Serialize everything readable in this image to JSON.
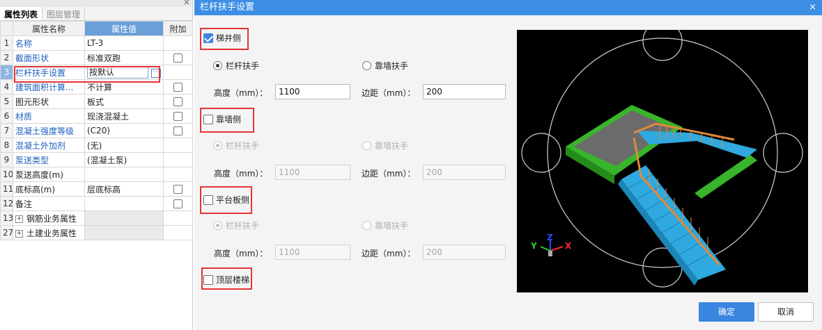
{
  "left_panel": {
    "tabs": [
      "属性列表",
      "图层管理"
    ],
    "columns": [
      "属性名称",
      "属性值",
      "附加"
    ],
    "rows": [
      {
        "num": "1",
        "name": "名称",
        "value": "LT-3"
      },
      {
        "num": "2",
        "name": "截面形状",
        "value": "标准双跑"
      },
      {
        "num": "3",
        "name": "栏杆扶手设置",
        "value": "按默认"
      },
      {
        "num": "4",
        "name": "建筑面积计算...",
        "value": "不计算"
      },
      {
        "num": "5",
        "name": "图元形状",
        "value": "板式"
      },
      {
        "num": "6",
        "name": "材质",
        "value": "现浇混凝土"
      },
      {
        "num": "7",
        "name": "混凝土强度等级",
        "value": "(C20)"
      },
      {
        "num": "8",
        "name": "混凝土外加剂",
        "value": "(无)"
      },
      {
        "num": "9",
        "name": "泵送类型",
        "value": "(混凝土泵)"
      },
      {
        "num": "10",
        "name": "泵送高度(m)",
        "value": ""
      },
      {
        "num": "11",
        "name": "底标高(m)",
        "value": "层底标高"
      },
      {
        "num": "12",
        "name": "备注",
        "value": ""
      },
      {
        "num": "13",
        "name": "钢筋业务属性",
        "value": ""
      },
      {
        "num": "27",
        "name": "土建业务属性",
        "value": ""
      }
    ],
    "expand_symbol": "+",
    "dots_symbol": "···",
    "close_symbol": "×"
  },
  "dialog": {
    "title": "栏杆扶手设置",
    "close_symbol": "×",
    "groups": [
      {
        "label": "梯井侧",
        "checked": true,
        "radio1": "栏杆扶手",
        "radio2": "靠墙扶手",
        "height_label": "高度（mm）：",
        "height": "1100",
        "margin_label": "边距（mm）：",
        "margin": "200"
      },
      {
        "label": "靠墙侧",
        "checked": false,
        "radio1": "栏杆扶手",
        "radio2": "靠墙扶手",
        "height_label": "高度（mm）：",
        "height": "1100",
        "margin_label": "边距（mm）：",
        "margin": "200"
      },
      {
        "label": "平台板侧",
        "checked": false,
        "radio1": "栏杆扶手",
        "radio2": "靠墙扶手",
        "height_label": "高度（mm）：",
        "height": "1100",
        "margin_label": "边距（mm）：",
        "margin": "200"
      }
    ],
    "top_floor": {
      "label": "顶层楼梯",
      "checked": false
    },
    "ok": "确定",
    "cancel": "取消",
    "axis_labels": {
      "x": "X",
      "y": "Y",
      "z": "Z"
    },
    "colors": {
      "title_bar": "#3d8ee5",
      "highlight_box": "#e53333",
      "stair_green": "#38b52a",
      "stair_blue": "#2fa9df",
      "railing_orange": "#e08a3a"
    }
  }
}
